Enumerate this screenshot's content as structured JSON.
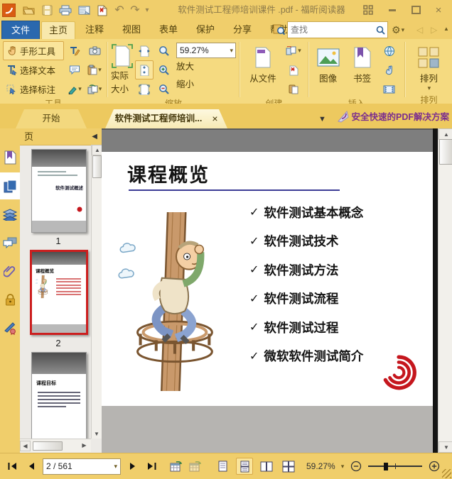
{
  "window": {
    "title": "软件测试工程师培训课件 .pdf - 福昕阅读器"
  },
  "icons": {
    "caret": "▾",
    "close": "×",
    "gear": "⚙",
    "up": "▲",
    "down": "▼",
    "left": "◀",
    "right": "▶",
    "back": "◁",
    "forward": "▷",
    "undo": "↶",
    "redo": "↷",
    "collapse": "▲"
  },
  "menu": {
    "file": "文件",
    "items": [
      "主页",
      "注释",
      "视图",
      "表单",
      "保护",
      "分享",
      "帮助"
    ],
    "search_placeholder": "查找"
  },
  "ribbon": {
    "tools": {
      "hand": "手形工具",
      "select_text": "选择文本",
      "select_annot": "选择标注",
      "label": "工具"
    },
    "zoom": {
      "actual": "实际大小",
      "value": "59.27%",
      "zoom_in": "放大",
      "zoom_out": "缩小",
      "label": "缩放"
    },
    "create": {
      "from_file": "从文件",
      "label": "创建"
    },
    "insert": {
      "image": "图像",
      "bookmark": "书签",
      "label": "插入"
    },
    "arrange": {
      "button": "排列",
      "label": "排列"
    }
  },
  "tabbar": {
    "start": "开始",
    "doc": "软件测试工程师培训...",
    "promo": "安全快速的PDF解决方案"
  },
  "panel": {
    "title": "页",
    "thumbs": [
      {
        "num": "1",
        "title": "软件测试概述"
      },
      {
        "num": "2",
        "title": "课程概览"
      },
      {
        "num": "3",
        "title": "课程目标"
      }
    ]
  },
  "slide": {
    "title": "课程概览",
    "check": "✓",
    "items": [
      "软件测试基本概念",
      "软件测试技术",
      "软件测试方法",
      "软件测试流程",
      "软件测试过程",
      "微软软件测试简介"
    ]
  },
  "status": {
    "page": "2 / 561",
    "zoom": "59.27%"
  }
}
